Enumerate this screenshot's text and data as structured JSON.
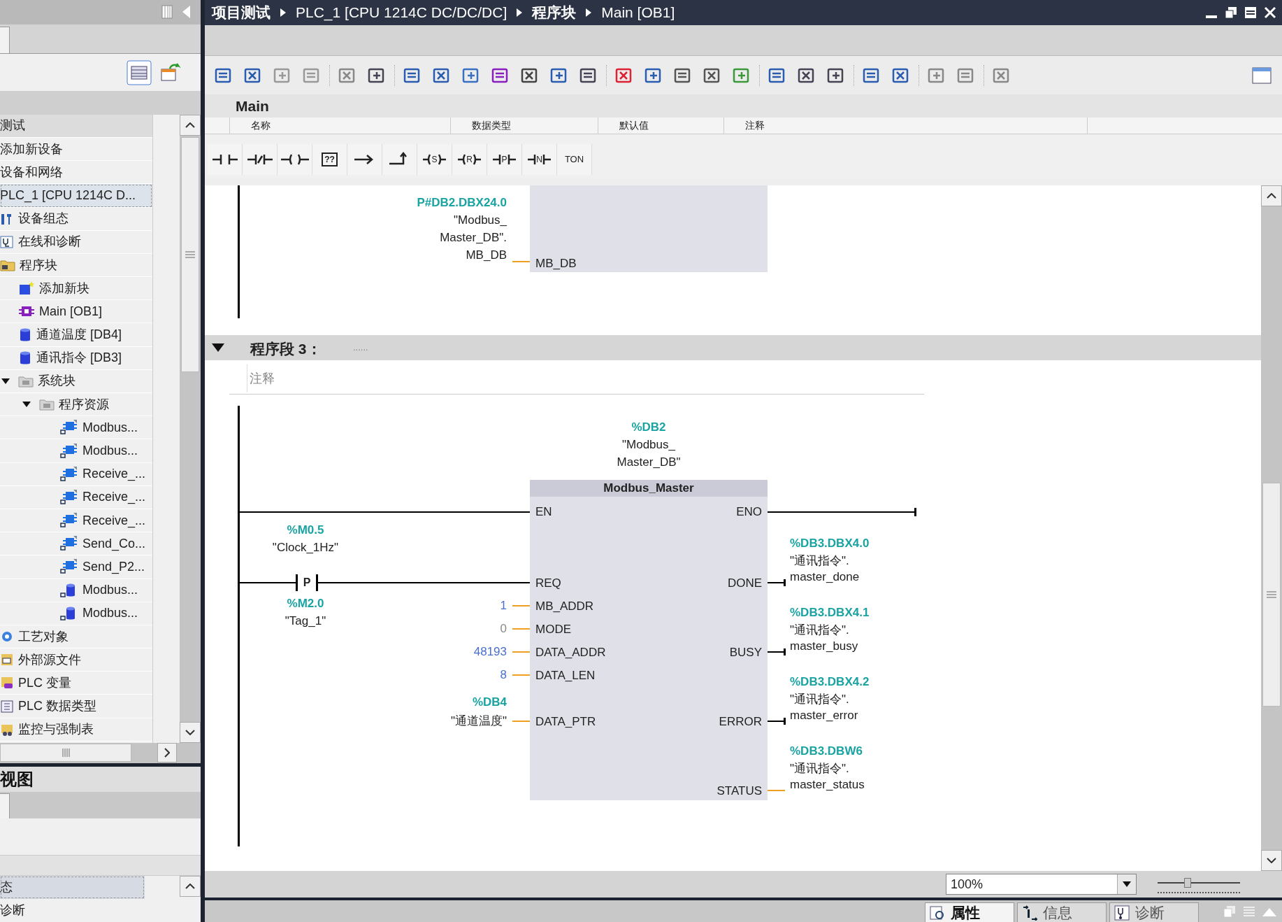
{
  "title_bar": {
    "breadcrumbs": [
      "项目测试",
      "PLC_1 [CPU 1214C DC/DC/DC]",
      "程序块",
      "Main [OB1]"
    ]
  },
  "project_tree": {
    "items": [
      {
        "label": "测试",
        "selected": false,
        "children": [
          {
            "label": "添加新设备",
            "selected": false
          },
          {
            "label": "设备和网络",
            "selected": false
          },
          {
            "label": "PLC_1 [CPU 1214C D...",
            "selected": true,
            "children": [
              {
                "label": "设备组态",
                "kind": "wrench",
                "selected": false
              },
              {
                "label": "在线和诊断",
                "kind": "diag",
                "selected": false
              },
              {
                "label": "程序块",
                "kind": "folder",
                "selected": false,
                "children": [
                  {
                    "label": "添加新块",
                    "kind": "addblock",
                    "selected": false
                  },
                  {
                    "label": "Main [OB1]",
                    "kind": "ob",
                    "selected": false
                  },
                  {
                    "label": "通道温度 [DB4]",
                    "kind": "db",
                    "selected": false
                  },
                  {
                    "label": "通讯指令 [DB3]",
                    "kind": "db",
                    "selected": false
                  },
                  {
                    "label": "系统块",
                    "kind": "sysfolder",
                    "expanded": true,
                    "selected": false,
                    "children": [
                      {
                        "label": "程序资源",
                        "kind": "sysfolder",
                        "expanded": true,
                        "selected": false,
                        "children": [
                          {
                            "label": "Modbus...",
                            "kind": "fb",
                            "selected": false
                          },
                          {
                            "label": "Modbus...",
                            "kind": "fb",
                            "selected": false
                          },
                          {
                            "label": "Receive_...",
                            "kind": "fb",
                            "selected": false
                          },
                          {
                            "label": "Receive_...",
                            "kind": "fb",
                            "selected": false
                          },
                          {
                            "label": "Receive_...",
                            "kind": "fb",
                            "selected": false
                          },
                          {
                            "label": "Send_Co...",
                            "kind": "fb",
                            "selected": false
                          },
                          {
                            "label": "Send_P2...",
                            "kind": "fb",
                            "selected": false
                          },
                          {
                            "label": "Modbus...",
                            "kind": "lockdb",
                            "selected": false
                          },
                          {
                            "label": "Modbus...",
                            "kind": "lockdb",
                            "selected": false
                          }
                        ]
                      }
                    ]
                  }
                ]
              },
              {
                "label": "工艺对象",
                "kind": "tech",
                "selected": false
              },
              {
                "label": "外部源文件",
                "kind": "source",
                "selected": false
              },
              {
                "label": "PLC 变量",
                "kind": "tags",
                "selected": false
              },
              {
                "label": "PLC 数据类型",
                "kind": "types",
                "selected": false
              },
              {
                "label": "监控与强制表",
                "kind": "watch",
                "selected": false
              }
            ]
          }
        ]
      }
    ]
  },
  "detail_view": {
    "title": "视图",
    "rows": [
      {
        "label": "态",
        "selected": true
      },
      {
        "label": "诊断",
        "selected": false
      }
    ]
  },
  "editor": {
    "block_name": "Main",
    "interface_columns": [
      "名称",
      "数据类型",
      "默认值",
      "注释"
    ],
    "instructions": [
      {
        "kind": "contact"
      },
      {
        "kind": "nc_contact"
      },
      {
        "kind": "coil"
      },
      {
        "kind": "box",
        "label": "??"
      },
      {
        "kind": "branch_open"
      },
      {
        "kind": "branch_close"
      },
      {
        "kind": "coil_letter",
        "label": "S"
      },
      {
        "kind": "coil_letter",
        "label": "R"
      },
      {
        "kind": "contact_letter",
        "label": "P"
      },
      {
        "kind": "contact_letter",
        "label": "N"
      },
      {
        "kind": "text",
        "label": "TON"
      }
    ],
    "network2": {
      "address": "P#DB2.DBX24.0",
      "operand": [
        "\"Modbus_",
        "Master_DB\".",
        "MB_DB"
      ],
      "pin": "MB_DB"
    },
    "network3": {
      "title": "程序段 3：",
      "expanded": true,
      "title_suffix": "......",
      "comment_placeholder": "注释",
      "instance": {
        "address": "%DB2",
        "name": [
          "\"Modbus_",
          "Master_DB\""
        ]
      },
      "contact": {
        "label": "P",
        "top_address": "%M0.5",
        "top_name": "\"Clock_1Hz\"",
        "bottom_address": "%M2.0",
        "bottom_name": "\"Tag_1\""
      },
      "block": {
        "name": "Modbus_Master",
        "en": "EN",
        "eno": "ENO",
        "rows": [
          {
            "in": {
              "pin": "REQ",
              "kind": "wire"
            },
            "out": {
              "pin": "DONE",
              "kind": "bool",
              "address": "%DB3.DBX4.0",
              "name": [
                "\"通讯指令\".",
                "master_done"
              ]
            }
          },
          {
            "in": {
              "pin": "MB_ADDR",
              "kind": "constant",
              "value": "1"
            }
          },
          {
            "in": {
              "pin": "MODE",
              "kind": "default",
              "value": "0"
            }
          },
          {
            "in": {
              "pin": "DATA_ADDR",
              "kind": "constant",
              "value": "48193"
            },
            "out": {
              "pin": "BUSY",
              "kind": "bool",
              "address": "%DB3.DBX4.1",
              "name": [
                "\"通讯指令\".",
                "master_busy"
              ]
            }
          },
          {
            "in": {
              "pin": "DATA_LEN",
              "kind": "constant",
              "value": "8"
            }
          },
          {},
          {
            "in": {
              "pin": "DATA_PTR",
              "kind": "tag",
              "address": "%DB4",
              "value": "\"通道温度\""
            },
            "out": {
              "pin": "ERROR",
              "kind": "bool",
              "address": "%DB3.DBX4.2",
              "name": [
                "\"通讯指令\".",
                "master_error"
              ]
            }
          },
          {},
          {},
          {
            "out": {
              "pin": "STATUS",
              "kind": "word",
              "address": "%DB3.DBW6",
              "name": [
                "\"通讯指令\".",
                "master_status"
              ]
            }
          }
        ]
      }
    }
  },
  "zoom": {
    "value": "100%",
    "level": 0.35
  },
  "bottom_tabs": [
    {
      "label": "属性",
      "kind": "props",
      "selected": true
    },
    {
      "label": "信息",
      "kind": "info",
      "selected": false
    },
    {
      "label": "诊断",
      "kind": "diag",
      "selected": false
    }
  ]
}
